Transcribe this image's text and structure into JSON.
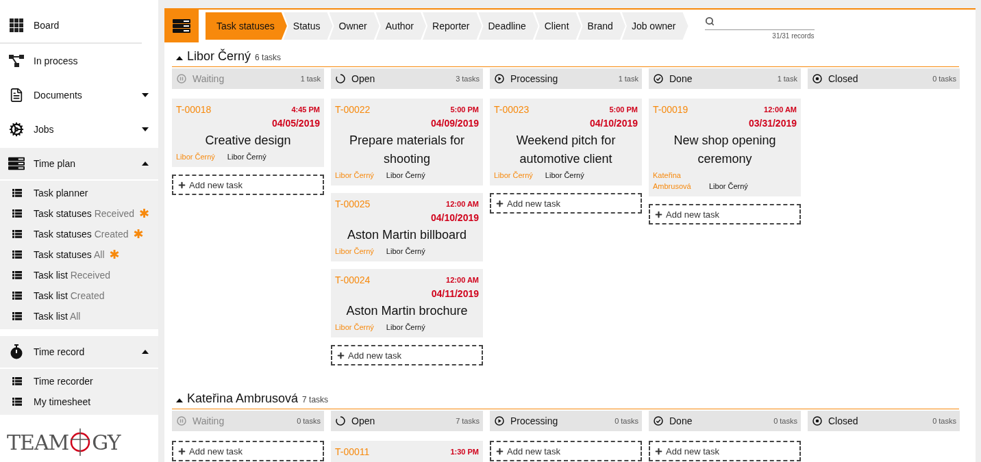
{
  "sidebar": {
    "items": [
      {
        "kind": "link",
        "label": "Board",
        "separated": true
      },
      {
        "kind": "link",
        "label": "In process",
        "separated": false
      },
      {
        "kind": "menu",
        "label": "Documents",
        "expanded": false,
        "separated": false
      },
      {
        "kind": "menu",
        "label": "Jobs",
        "expanded": false,
        "separated": false
      }
    ],
    "sections": [
      {
        "label": "Time plan",
        "expanded": true,
        "children": [
          {
            "label": "Task planner"
          },
          {
            "label": "Task statuses",
            "qualifier": "Received",
            "badge": "✱"
          },
          {
            "label": "Task statuses",
            "qualifier": "Created",
            "badge": "✱"
          },
          {
            "label": "Task statuses",
            "qualifier": "All",
            "badge": "✱"
          },
          {
            "label": "Task list",
            "qualifier": "Received"
          },
          {
            "label": "Task list",
            "qualifier": "Created"
          },
          {
            "label": "Task list",
            "qualifier": "All"
          }
        ]
      },
      {
        "label": "Time record",
        "expanded": true,
        "children": [
          {
            "label": "Time recorder"
          },
          {
            "label": "My timesheet"
          }
        ]
      }
    ],
    "logo": {
      "left": "TEAM",
      "right": "GY"
    }
  },
  "toolbar": {
    "tabs": [
      {
        "label": "Task statuses",
        "selected": true
      },
      {
        "label": "Status",
        "selected": false
      },
      {
        "label": "Owner",
        "selected": false
      },
      {
        "label": "Author",
        "selected": false
      },
      {
        "label": "Reporter",
        "selected": false
      },
      {
        "label": "Deadline",
        "selected": false
      },
      {
        "label": "Client",
        "selected": false
      },
      {
        "label": "Brand",
        "selected": false
      },
      {
        "label": "Job owner",
        "selected": false
      }
    ],
    "search": {
      "records": "31/31 records"
    }
  },
  "groups": [
    {
      "name": "Libor Černý",
      "count": "6 tasks",
      "expanded": true,
      "columns": [
        {
          "kind": "waiting",
          "label": "Waiting",
          "count": "1 task",
          "add": "Add new task",
          "cards": [
            {
              "id": "T-00018",
              "time": "4:45 PM",
              "date": "04/05/2019",
              "title": "Creative design",
              "owner": "Libor Černý",
              "author": "Libor Černý"
            }
          ]
        },
        {
          "kind": "open",
          "label": "Open",
          "count": "3 tasks",
          "add": "Add new task",
          "cards": [
            {
              "id": "T-00022",
              "time": "5:00 PM",
              "date": "04/09/2019",
              "title": "Prepare materials for shooting",
              "owner": "Libor Černý",
              "author": "Libor Černý"
            },
            {
              "id": "T-00025",
              "time": "12:00 AM",
              "date": "04/10/2019",
              "title": "Aston Martin billboard",
              "owner": "Libor Černý",
              "author": "Libor Černý"
            },
            {
              "id": "T-00024",
              "time": "12:00 AM",
              "date": "04/11/2019",
              "title": "Aston Martin brochure",
              "owner": "Libor Černý",
              "author": "Libor Černý"
            }
          ]
        },
        {
          "kind": "processing",
          "label": "Processing",
          "count": "1 task",
          "add": "Add new task",
          "cards": [
            {
              "id": "T-00023",
              "time": "5:00 PM",
              "date": "04/10/2019",
              "title": "Weekend pitch for automotive client",
              "owner": "Libor Černý",
              "author": "Libor Černý"
            }
          ]
        },
        {
          "kind": "done",
          "label": "Done",
          "count": "1 task",
          "add": "Add new task",
          "cards": [
            {
              "id": "T-00019",
              "time": "12:00 AM",
              "date": "03/31/2019",
              "title": "New shop opening ceremony",
              "owner": "Kateřina Ambrusová",
              "author": "Libor Černý"
            }
          ]
        },
        {
          "kind": "closed",
          "label": "Closed",
          "count": "0 tasks"
        }
      ]
    },
    {
      "name": "Kateřina Ambrusová",
      "count": "7 tasks",
      "expanded": true,
      "columns": [
        {
          "kind": "waiting",
          "label": "Waiting",
          "count": "0 tasks",
          "add": "Add new task"
        },
        {
          "kind": "open",
          "label": "Open",
          "count": "7 tasks",
          "cards": [
            {
              "id": "T-00011",
              "time": "1:30 PM"
            }
          ]
        },
        {
          "kind": "processing",
          "label": "Processing",
          "count": "0 tasks",
          "add": "Add new task"
        },
        {
          "kind": "done",
          "label": "Done",
          "count": "0 tasks",
          "add": "Add new task"
        },
        {
          "kind": "closed",
          "label": "Closed",
          "count": "0 tasks"
        }
      ]
    }
  ]
}
